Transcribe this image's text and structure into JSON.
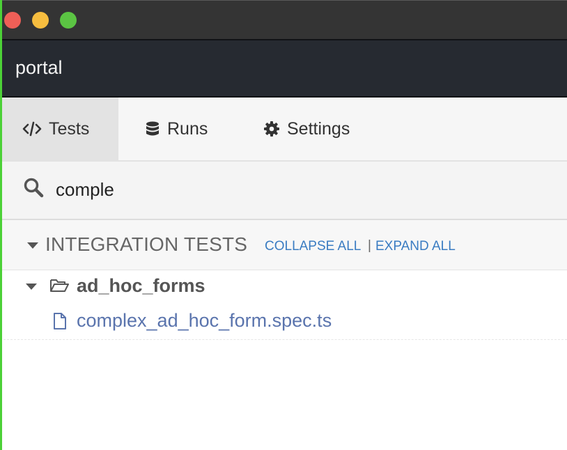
{
  "window": {
    "title_controls": [
      "close",
      "minimize",
      "maximize"
    ]
  },
  "header": {
    "title": "portal"
  },
  "nav": {
    "tabs": [
      {
        "label": "Tests",
        "icon": "code-icon",
        "active": true
      },
      {
        "label": "Runs",
        "icon": "database-icon",
        "active": false
      },
      {
        "label": "Settings",
        "icon": "gear-icon",
        "active": false
      }
    ]
  },
  "search": {
    "value": "comple",
    "icon": "search-icon"
  },
  "specs": {
    "section_title": "INTEGRATION TESTS",
    "collapse_all": "COLLAPSE ALL",
    "separator": "|",
    "expand_all": "EXPAND ALL",
    "folders": [
      {
        "name": "ad_hoc_forms",
        "expanded": true,
        "files": [
          {
            "name": "complex_ad_hoc_form.spec.ts"
          }
        ]
      }
    ]
  },
  "colors": {
    "titlebar": "#343434",
    "header": "#262a31",
    "link": "#3a7cc2",
    "file_link": "#5a74ad",
    "active_tab": "#e3e3e3"
  }
}
